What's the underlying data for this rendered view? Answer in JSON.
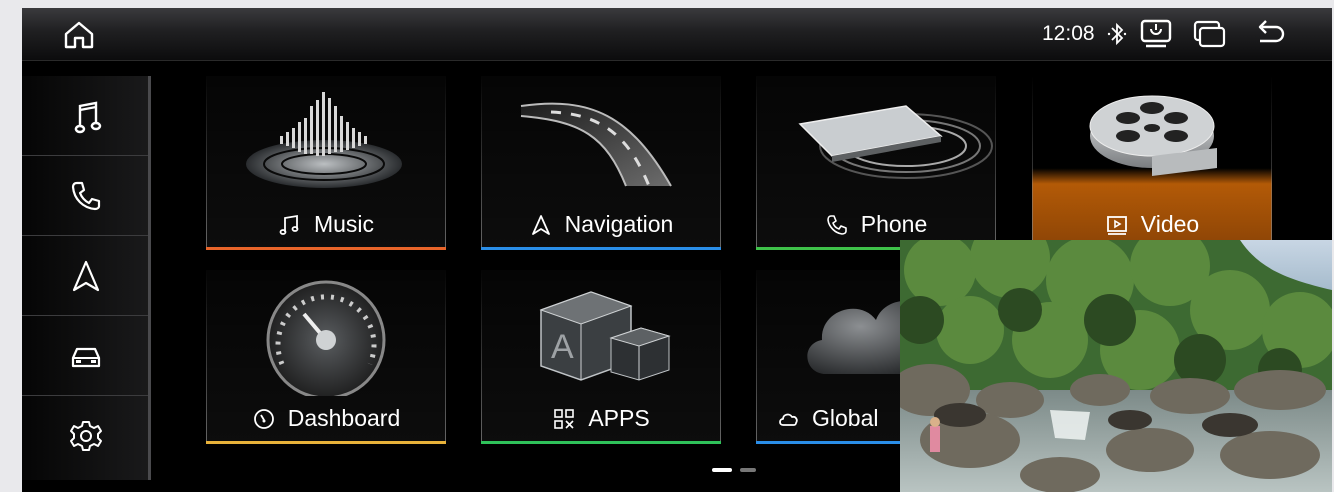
{
  "status_bar": {
    "time": "12:08",
    "icons": [
      "home-icon",
      "bluetooth-icon",
      "screen-mirror-icon",
      "recent-apps-icon",
      "back-icon"
    ]
  },
  "sidebar": {
    "items": [
      {
        "name": "music-note-icon"
      },
      {
        "name": "phone-icon"
      },
      {
        "name": "navigation-arrow-icon"
      },
      {
        "name": "car-icon"
      },
      {
        "name": "settings-gear-icon"
      }
    ]
  },
  "tiles": [
    {
      "label": "Music",
      "icon": "music-note-icon",
      "accent": "#e8652a"
    },
    {
      "label": "Navigation",
      "icon": "navigation-arrow-icon",
      "accent": "#2a8ee8"
    },
    {
      "label": "Phone",
      "icon": "phone-icon",
      "accent": "#3fc24a"
    },
    {
      "label": "Video",
      "icon": "video-play-icon",
      "accent": "#d97a16",
      "active": true
    },
    {
      "label": "Dashboard",
      "icon": "speedometer-icon",
      "accent": "#e8b23a"
    },
    {
      "label": "APPS",
      "icon": "apps-grid-icon",
      "accent": "#2fc25a"
    },
    {
      "label": "Global",
      "icon": "cloud-icon",
      "accent": "#2a8ee8"
    }
  ],
  "pager": {
    "pages": 2,
    "current": 1
  },
  "pip": {
    "content": "video-thumbnail-river-forest"
  },
  "colors": {
    "background": "#000000",
    "topbar": "#1f1f21",
    "active_tile": "#b35a07",
    "text": "#ffffff"
  }
}
